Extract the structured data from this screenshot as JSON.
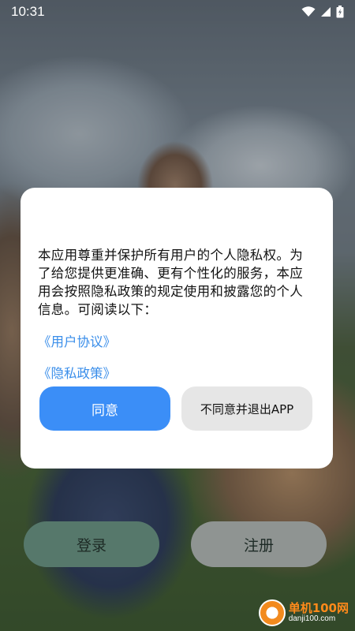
{
  "status_bar": {
    "time": "10:31",
    "icons": [
      "wifi-icon",
      "signal-icon",
      "battery-charging-icon"
    ]
  },
  "dialog": {
    "message": "本应用尊重并保护所有用户的个人隐私权。为了给您提供更准确、更有个性化的服务，本应用会按照隐私政策的规定使用和披露您的个人信息。可阅读以下：",
    "links": [
      "《用户协议》",
      "《隐私政策》"
    ],
    "agree_label": "同意",
    "disagree_label": "不同意并退出APP",
    "colors": {
      "agree": "#3b8ef7",
      "link": "#3a8eea"
    }
  },
  "bottom": {
    "login_label": "登录",
    "register_label": "注册",
    "colors": {
      "login": "#56786b",
      "register": "#8f9492"
    }
  },
  "watermark": {
    "name": "单机100网",
    "domain": "danji100.com"
  }
}
